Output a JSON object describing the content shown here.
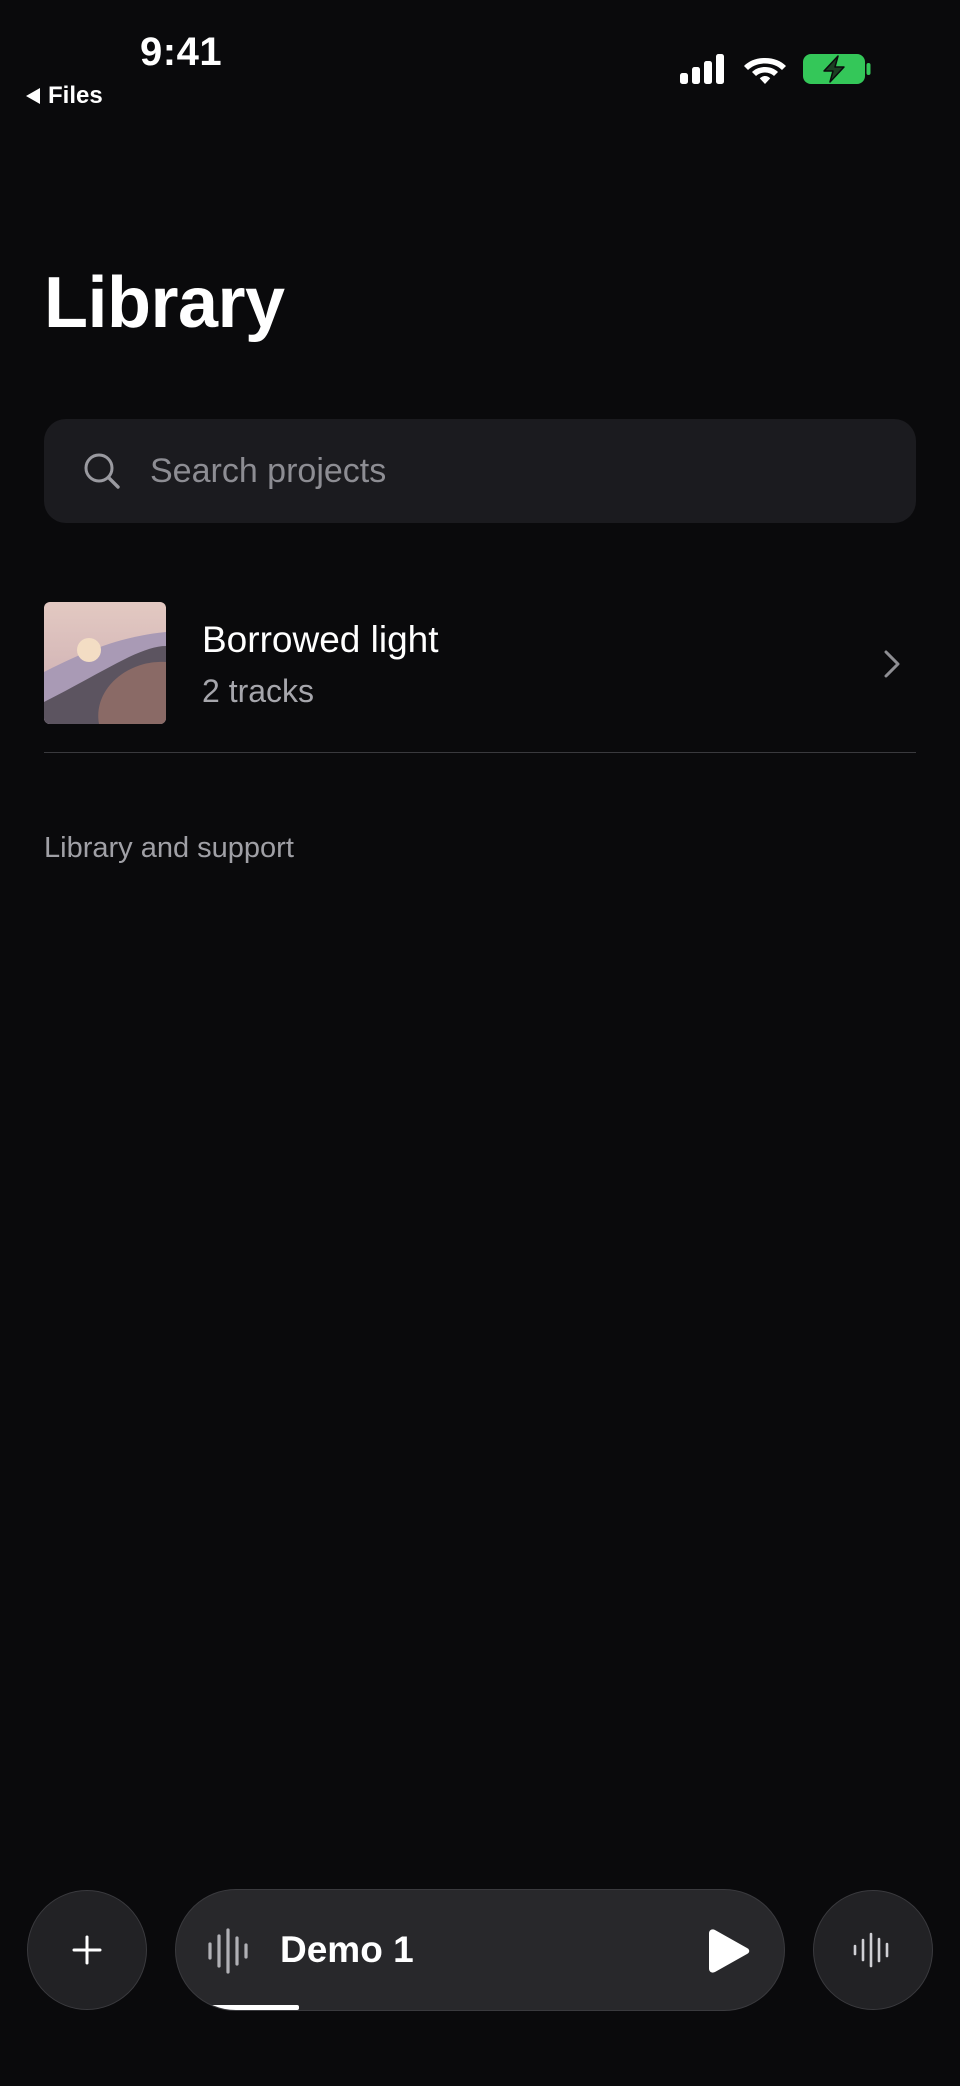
{
  "status_bar": {
    "time": "9:41",
    "back_label": "Files",
    "battery_color": "#34c759"
  },
  "header": {
    "title": "Library"
  },
  "search": {
    "placeholder": "Search projects",
    "value": ""
  },
  "projects": [
    {
      "title": "Borrowed light",
      "subtitle": "2 tracks"
    }
  ],
  "section": {
    "label": "Library and support"
  },
  "player": {
    "track_title": "Demo 1",
    "progress": 0.17,
    "state": "paused"
  },
  "icons": {
    "add": "plus-icon",
    "waveform": "waveform-icon",
    "play": "play-icon",
    "search": "search-icon",
    "chevron": "chevron-right-icon"
  }
}
